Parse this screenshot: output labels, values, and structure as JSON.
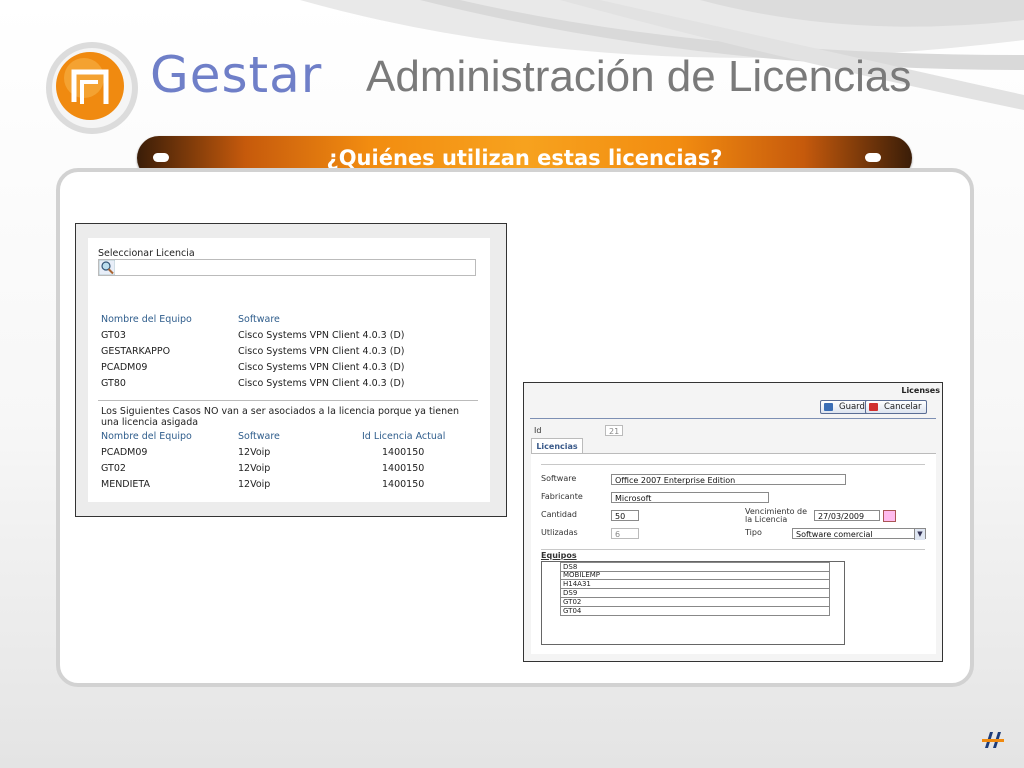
{
  "header": {
    "brand": "Gestar",
    "title": "Administración de Licencias"
  },
  "banner": {
    "text": "¿Quiénes utilizan estas licencias?"
  },
  "left_panel": {
    "select_label": "Seleccionar Licencia",
    "columns": [
      "Nombre del Equipo",
      "Software"
    ],
    "rows": [
      {
        "equipo": "GT03",
        "software": "Cisco Systems VPN Client 4.0.3 (D)"
      },
      {
        "equipo": "GESTARKAPPO",
        "software": "Cisco Systems VPN Client 4.0.3 (D)"
      },
      {
        "equipo": "PCADM09",
        "software": "Cisco Systems VPN Client 4.0.3 (D)"
      },
      {
        "equipo": "GT80",
        "software": "Cisco Systems VPN Client 4.0.3 (D)"
      }
    ],
    "note": "Los Siguientes Casos NO van a ser asociados a la licencia porque ya tienen una licencia asigada",
    "columns2": [
      "Nombre del Equipo",
      "Software",
      "Id Licencia Actual"
    ],
    "rows2": [
      {
        "equipo": "PCADM09",
        "software": "12Voip",
        "id": "1400150"
      },
      {
        "equipo": "GT02",
        "software": "12Voip",
        "id": "1400150"
      },
      {
        "equipo": "MENDIETA",
        "software": "12Voip",
        "id": "1400150"
      }
    ]
  },
  "right_panel": {
    "title": "Licenses",
    "save_label": "Guardar",
    "cancel_label": "Cancelar",
    "id_label": "Id",
    "id_value": "21",
    "tab_label": "Licencias",
    "software_label": "Software",
    "software_value": "Office 2007 Enterprise Edition",
    "fabricante_label": "Fabricante",
    "fabricante_value": "Microsoft",
    "cantidad_label": "Cantidad",
    "cantidad_value": "50",
    "vencimiento_label_1": "Vencimiento de",
    "vencimiento_label_2": "la Licencia",
    "vencimiento_value": "27/03/2009",
    "utilizadas_label": "Utlizadas",
    "utilizadas_value": "6",
    "tipo_label": "Tipo",
    "tipo_value": "Software comercial",
    "equipos_label": "Equipos",
    "equipos": [
      "DS8",
      "MOBILEMP",
      "H14A31",
      "DS9",
      "GT02",
      "GT04"
    ]
  },
  "colors": {
    "banner_orange": "#f28c10",
    "brand_blue": "#6f7fc8",
    "link_blue": "#2f5d8c"
  }
}
